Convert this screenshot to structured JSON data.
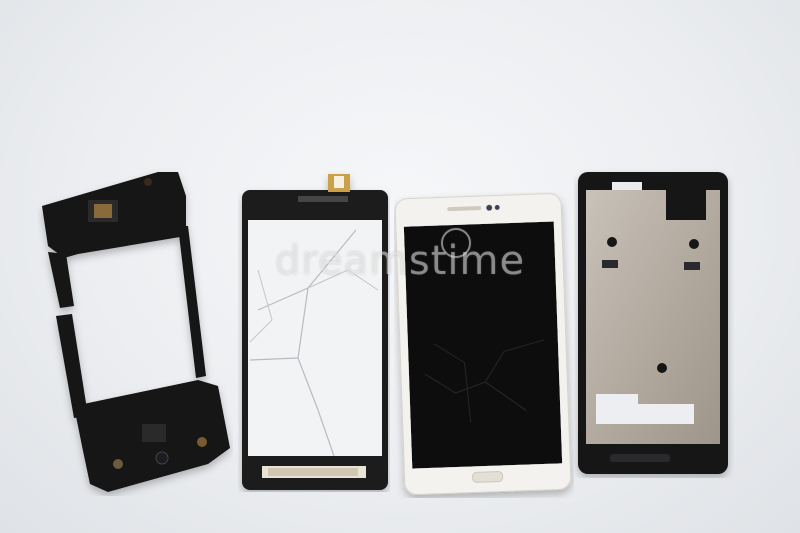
{
  "scene": {
    "description_items": [
      "frame-part",
      "cracked-touch-glass",
      "white-phone-broken-display",
      "metal-mid-frame"
    ]
  },
  "watermark": {
    "text": "dreamstime"
  },
  "colors": {
    "background": "#eceef1",
    "plastic": "#111214",
    "glass": "#f2f3f4",
    "phone_body": "#f4f2ee",
    "display": "#0b0b0c",
    "metal": "#b9b1a8"
  }
}
